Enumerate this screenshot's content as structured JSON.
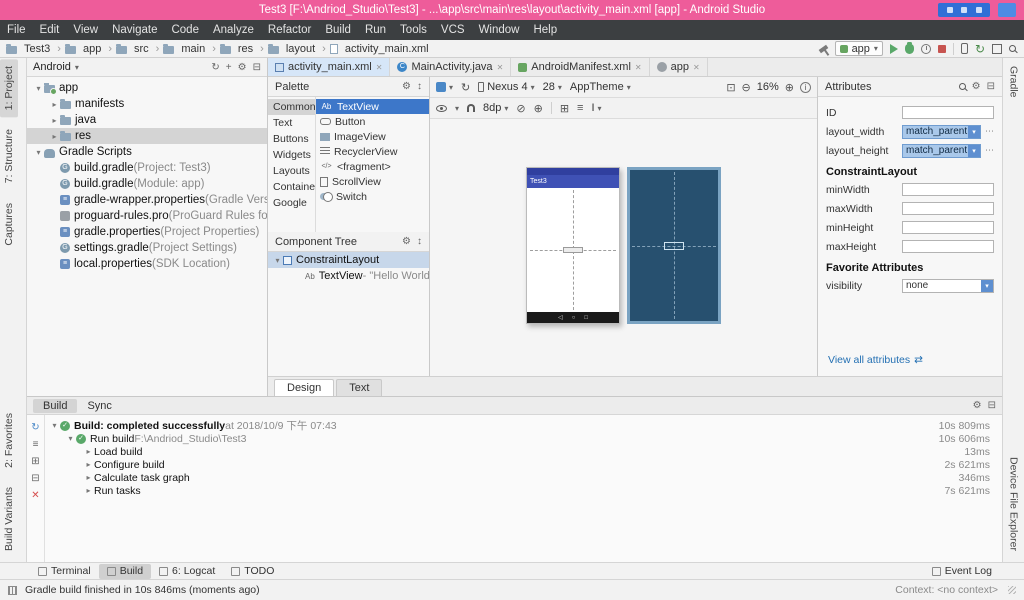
{
  "titlebar": {
    "title": "Test3 [F:\\Andriod_Studio\\Test3] - ...\\app\\src\\main\\res\\layout\\activity_main.xml [app] - Android Studio"
  },
  "menubar": {
    "items": [
      {
        "label": "File"
      },
      {
        "label": "Edit"
      },
      {
        "label": "View"
      },
      {
        "label": "Navigate"
      },
      {
        "label": "Code"
      },
      {
        "label": "Analyze"
      },
      {
        "label": "Refactor"
      },
      {
        "label": "Build"
      },
      {
        "label": "Run"
      },
      {
        "label": "Tools"
      },
      {
        "label": "VCS"
      },
      {
        "label": "Window"
      },
      {
        "label": "Help"
      }
    ]
  },
  "toolbar": {
    "breadcrumbs": [
      {
        "label": "Test3",
        "icon": "i-folder"
      },
      {
        "label": "app",
        "icon": "i-folder"
      },
      {
        "label": "src",
        "icon": "i-folder"
      },
      {
        "label": "main",
        "icon": "i-folder"
      },
      {
        "label": "res",
        "icon": "i-folder"
      },
      {
        "label": "layout",
        "icon": "i-folder"
      },
      {
        "label": "activity_main.xml",
        "icon": "i-file"
      }
    ],
    "run_config": "app"
  },
  "left_strip": {
    "top": [
      {
        "label": "1: Project",
        "cls": "active"
      },
      {
        "label": "7: Structure",
        "cls": ""
      },
      {
        "label": "Captures",
        "cls": ""
      }
    ],
    "bottom": [
      {
        "label": "2: Favorites",
        "cls": ""
      },
      {
        "label": "Build Variants",
        "cls": ""
      }
    ]
  },
  "right_strip": {
    "top": [
      {
        "label": "Gradle",
        "cls": ""
      }
    ],
    "bottom": [
      {
        "label": "Device File Explorer",
        "cls": ""
      }
    ]
  },
  "project": {
    "header_label": "Android",
    "tree": [
      {
        "chev": "▾",
        "icon": "i-folder-app",
        "label": "app",
        "note": "",
        "cls": "lvl0"
      },
      {
        "chev": "▸",
        "icon": "i-folder",
        "label": "manifests",
        "note": "",
        "cls": "lvl1"
      },
      {
        "chev": "▸",
        "icon": "i-folder",
        "label": "java",
        "note": "",
        "cls": "lvl1"
      },
      {
        "chev": "▸",
        "icon": "i-folder",
        "label": "res",
        "note": "",
        "cls": "lvl1 selected"
      },
      {
        "chev": "▾",
        "icon": "i-gradle",
        "label": "Gradle Scripts",
        "note": "",
        "cls": "lvl0"
      },
      {
        "chev": "",
        "icon": "i-gradlefile",
        "label": "build.gradle",
        "note": " (Project: Test3)",
        "cls": "lvl1"
      },
      {
        "chev": "",
        "icon": "i-gradlefile",
        "label": "build.gradle",
        "note": " (Module: app)",
        "cls": "lvl1"
      },
      {
        "chev": "",
        "icon": "i-props",
        "label": "gradle-wrapper.properties",
        "note": " (Gradle Version)",
        "cls": "lvl1"
      },
      {
        "chev": "",
        "icon": "i-pro",
        "label": "proguard-rules.pro",
        "note": " (ProGuard Rules for app)",
        "cls": "lvl1"
      },
      {
        "chev": "",
        "icon": "i-props",
        "label": "gradle.properties",
        "note": " (Project Properties)",
        "cls": "lvl1"
      },
      {
        "chev": "",
        "icon": "i-gradlefile",
        "label": "settings.gradle",
        "note": " (Project Settings)",
        "cls": "lvl1"
      },
      {
        "chev": "",
        "icon": "i-props",
        "label": "local.properties",
        "note": " (SDK Location)",
        "cls": "lvl1"
      }
    ]
  },
  "editor": {
    "tabs": [
      {
        "label": "activity_main.xml",
        "icon": "ti-layout",
        "cls": "selected"
      },
      {
        "label": "MainActivity.java",
        "icon": "ti-class",
        "cls": ""
      },
      {
        "label": "AndroidManifest.xml",
        "icon": "ti-manifest",
        "cls": ""
      },
      {
        "label": "app",
        "icon": "ti-gradle",
        "cls": ""
      }
    ],
    "bottom_tabs": [
      {
        "label": "Design"
      },
      {
        "label": "Text"
      }
    ]
  },
  "palette": {
    "title": "Palette",
    "categories": [
      {
        "label": "Common",
        "cls": "selected"
      },
      {
        "label": "Text",
        "cls": ""
      },
      {
        "label": "Buttons",
        "cls": ""
      },
      {
        "label": "Widgets",
        "cls": ""
      },
      {
        "label": "Layouts",
        "cls": ""
      },
      {
        "label": "Containe",
        "cls": ""
      },
      {
        "label": "Google",
        "cls": ""
      }
    ],
    "items": [
      {
        "icon": "pi-ab",
        "label": "TextView",
        "cls": "selected"
      },
      {
        "icon": "pi-btn",
        "label": "Button",
        "cls": ""
      },
      {
        "icon": "pi-img",
        "label": "ImageView",
        "cls": ""
      },
      {
        "icon": "pi-list",
        "label": "RecyclerView",
        "cls": ""
      },
      {
        "icon": "pi-frag",
        "label": "<fragment>",
        "cls": ""
      },
      {
        "icon": "pi-scroll",
        "label": "ScrollView",
        "cls": ""
      },
      {
        "icon": "pi-switch",
        "label": "Switch",
        "cls": ""
      }
    ]
  },
  "component_tree": {
    "title": "Component Tree",
    "items": [
      {
        "chev": "▾",
        "icon": "ci-layout",
        "label": "ConstraintLayout",
        "note": "",
        "cls": "lvl0 selected"
      },
      {
        "chev": "",
        "icon": "pi-ab",
        "label": "TextView",
        "note": " - \"Hello World!\"",
        "cls": "lvl1"
      }
    ]
  },
  "design_toolbar": {
    "device": "Nexus 4",
    "api": "28",
    "theme": "AppTheme",
    "zoom": "16%",
    "margin": "8dp"
  },
  "preview": {
    "app_title": "Test3"
  },
  "attributes": {
    "title": "Attributes",
    "id_label": "ID",
    "width_label": "layout_width",
    "width_value": "match_parent",
    "height_label": "layout_height",
    "height_value": "match_parent",
    "section_constraint": "ConstraintLayout",
    "min_width": "minWidth",
    "max_width": "maxWidth",
    "min_height": "minHeight",
    "max_height": "maxHeight",
    "section_favorites": "Favorite Attributes",
    "visibility_label": "visibility",
    "visibility_value": "none",
    "view_all": "View all attributes"
  },
  "build": {
    "tabs": [
      {
        "label": "Build"
      },
      {
        "label": "Sync"
      }
    ],
    "rows": [
      {
        "chev": "▾",
        "icon": "check",
        "title": "Build: completed successfully",
        "note": " at 2018/10/9 下午 07:43",
        "time": "10s 809ms",
        "cls": "ind0 bold"
      },
      {
        "chev": "▾",
        "icon": "check",
        "title": "Run build",
        "note": " F:\\Andriod_Studio\\Test3",
        "time": "10s 606ms",
        "cls": "ind1"
      },
      {
        "chev": "▸",
        "icon": "none",
        "title": "Load build",
        "note": "",
        "time": "13ms",
        "cls": "ind2"
      },
      {
        "chev": "▸",
        "icon": "none",
        "title": "Configure build",
        "note": "",
        "time": "2s 621ms",
        "cls": "ind2"
      },
      {
        "chev": "▸",
        "icon": "none",
        "title": "Calculate task graph",
        "note": "",
        "time": "346ms",
        "cls": "ind2"
      },
      {
        "chev": "▸",
        "icon": "none",
        "title": "Run tasks",
        "note": "",
        "time": "7s 621ms",
        "cls": "ind2"
      }
    ]
  },
  "bottom_strip": {
    "left": [
      {
        "label": "Terminal"
      },
      {
        "label": "Build"
      },
      {
        "label": "6: Logcat"
      },
      {
        "label": "TODO"
      }
    ],
    "right": [
      {
        "label": "Event Log"
      }
    ]
  },
  "statusbar": {
    "message": "Gradle build finished in 10s 846ms (moments ago)",
    "context": "Context: <no context>"
  }
}
